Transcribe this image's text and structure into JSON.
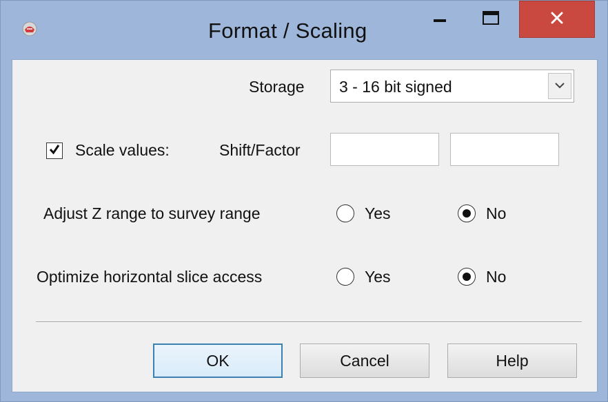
{
  "window": {
    "title": "Format / Scaling",
    "icons": {
      "app": "app-icon",
      "minimize": "minimize-icon",
      "maximize": "maximize-icon",
      "close": "close-icon"
    },
    "colors": {
      "frame": "#9db6d9",
      "close_button": "#c9483f",
      "client": "#f0f0f0",
      "default_button_border": "#3c7fb1"
    }
  },
  "storage": {
    "label": "Storage",
    "selected": "3 - 16 bit signed",
    "dropdown_icon": "chevron-down-icon"
  },
  "scale": {
    "checkbox_label": "Scale values:",
    "checked": true,
    "shift_factor_label": "Shift/Factor",
    "shift_value": "",
    "factor_value": ""
  },
  "adjust_z": {
    "label": "Adjust Z range to survey range",
    "yes_label": "Yes",
    "no_label": "No",
    "selected": "No"
  },
  "optimize": {
    "label": "Optimize horizontal slice access",
    "yes_label": "Yes",
    "no_label": "No",
    "selected": "No"
  },
  "buttons": {
    "ok": "OK",
    "cancel": "Cancel",
    "help": "Help"
  }
}
